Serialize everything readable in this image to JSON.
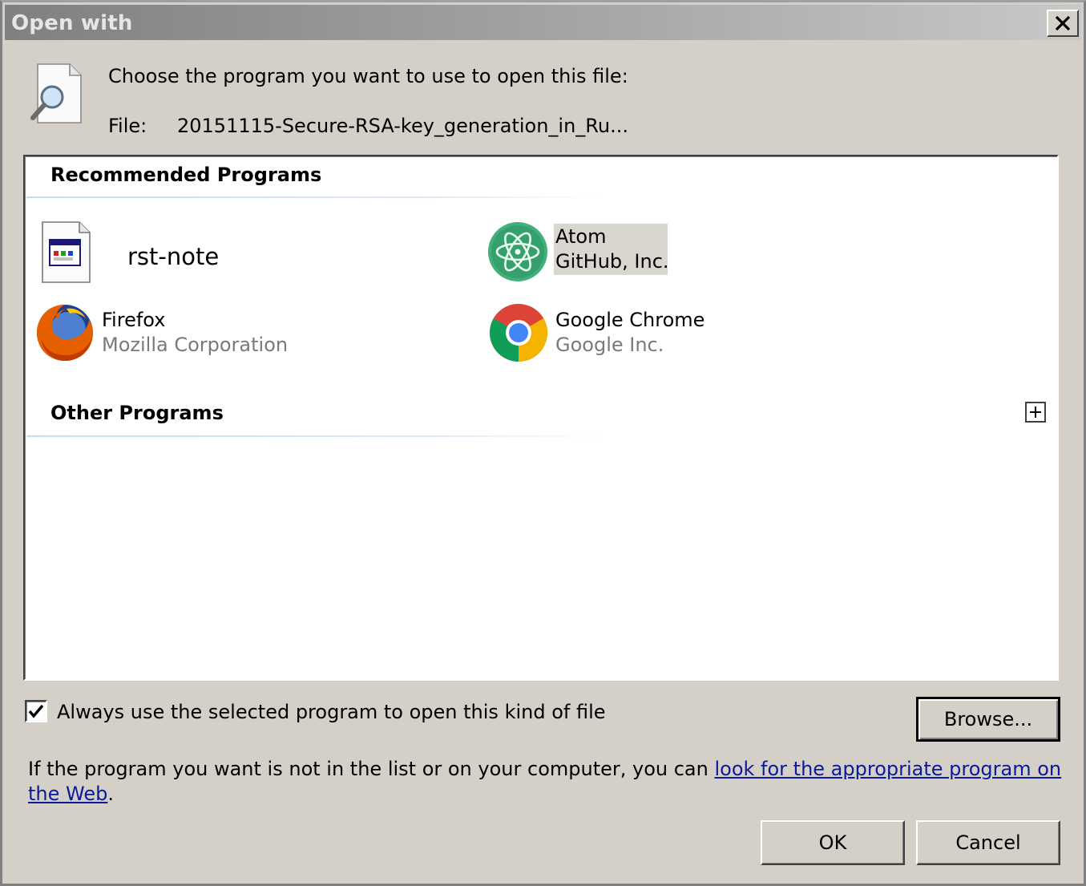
{
  "window": {
    "title": "Open with",
    "close_icon": "close-icon"
  },
  "header": {
    "prompt": "Choose the program you want to use to open this file:",
    "file_label": "File:",
    "file_name": "20151115-Secure-RSA-key_generation_in_Ru...",
    "icon": "document-magnifier-icon"
  },
  "recommended": {
    "header": "Recommended Programs",
    "programs": [
      {
        "name": "rst-note",
        "publisher": "",
        "icon": "rst-note-app-icon",
        "selected": false
      },
      {
        "name": "Atom",
        "publisher": "GitHub, Inc.",
        "icon": "atom-icon",
        "selected": true
      },
      {
        "name": "Firefox",
        "publisher": "Mozilla Corporation",
        "icon": "firefox-icon",
        "selected": false
      },
      {
        "name": "Google Chrome",
        "publisher": "Google Inc.",
        "icon": "chrome-icon",
        "selected": false
      }
    ]
  },
  "other": {
    "header": "Other Programs",
    "expand_icon": "plus-expand-icon"
  },
  "always_use": {
    "label": "Always use the selected program to open this kind of file",
    "checked": true
  },
  "help": {
    "text_before": "If the program you want is not in the list or on your computer, you can ",
    "link_text": "look for the appropriate program on the Web",
    "text_after": "."
  },
  "buttons": {
    "browse": "Browse...",
    "ok": "OK",
    "cancel": "Cancel"
  },
  "colors": {
    "dialog_bg": "#d4d0c8",
    "link": "#0b1a9c",
    "selection": "#d9d6cf",
    "firefox_orange": "#e66000",
    "atom_green": "#40b17b"
  }
}
